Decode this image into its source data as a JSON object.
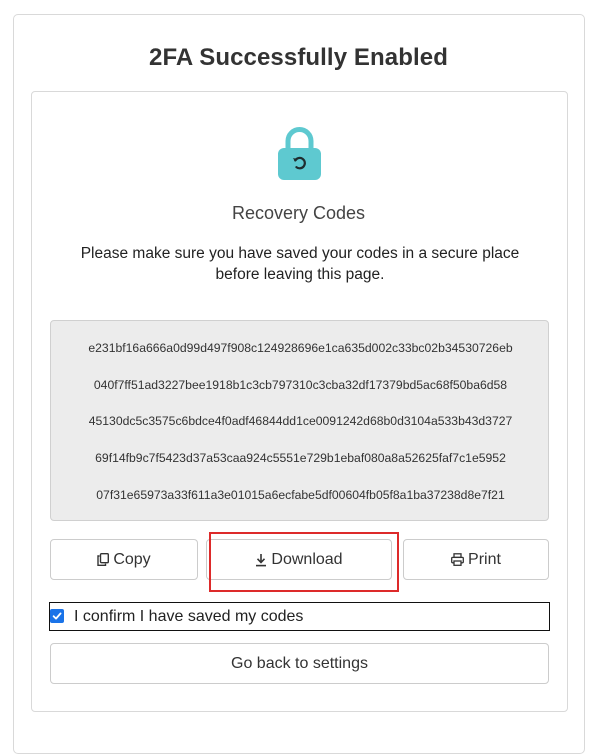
{
  "page": {
    "title": "2FA Successfully Enabled"
  },
  "recovery": {
    "lock_icon": "lock-icon",
    "lock_color": "#5ec9d0",
    "section_title": "Recovery Codes",
    "instructions": "Please make sure you have saved your codes in a secure place before leaving this page.",
    "codes": [
      "e231bf16a666a0d99d497f908c124928696e1ca635d002c33bc02b34530726eb",
      "040f7ff51ad3227bee1918b1c3cb797310c3cba32df17379bd5ac68f50ba6d58",
      "45130dc5c3575c6bdce4f0adf46844dd1ce0091242d68b0d3104a533b43d3727",
      "69f14fb9c7f5423d37a53caa924c5551e729b1ebaf080a8a52625faf7c1e5952",
      "07f31e65973a33f611a3e01015a6ecfabe5df00604fb05f8a1ba37238d8e7f21"
    ]
  },
  "actions": {
    "copy_label": "Copy",
    "copy_icon": "copy-icon",
    "download_label": "Download",
    "download_icon": "download-icon",
    "print_label": "Print",
    "print_icon": "print-icon"
  },
  "confirm": {
    "label": "I confirm I have saved my codes",
    "checked": true
  },
  "navigation": {
    "back_label": "Go back to settings"
  },
  "highlight": {
    "color": "#dd2a2a"
  }
}
